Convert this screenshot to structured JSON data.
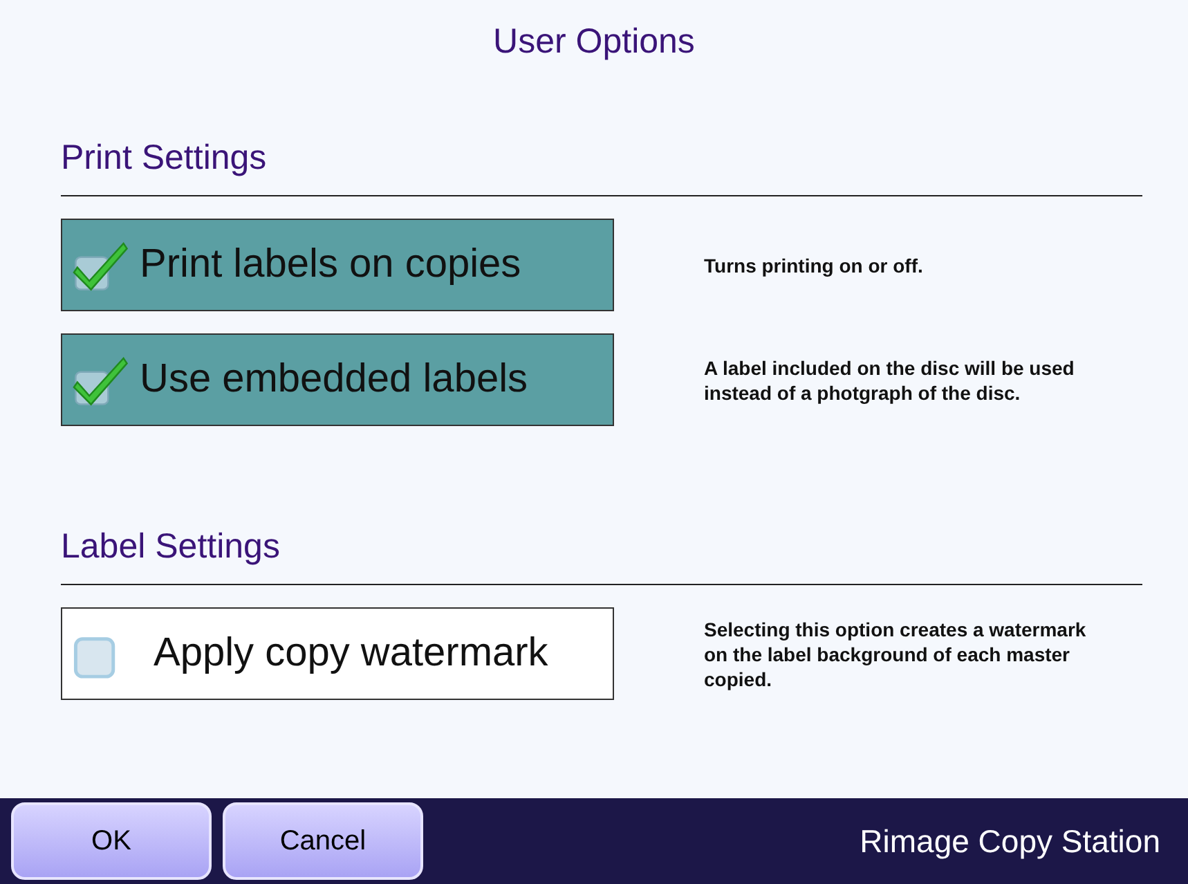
{
  "window": {
    "title": "User Options"
  },
  "sections": [
    {
      "heading": "Print Settings",
      "options": [
        {
          "label": "Print labels on copies",
          "checked": true,
          "description": "Turns printing on or off."
        },
        {
          "label": "Use embedded labels",
          "checked": true,
          "description": "A label included on the disc will be used instead of a photgraph of the disc."
        }
      ]
    },
    {
      "heading": "Label Settings",
      "options": [
        {
          "label": "Apply copy watermark",
          "checked": false,
          "description": "Selecting this option creates a watermark on the label background of each master copied."
        }
      ]
    }
  ],
  "buttons": [
    "OK",
    "Cancel"
  ],
  "footer": {
    "product": "Rimage Copy Station"
  }
}
